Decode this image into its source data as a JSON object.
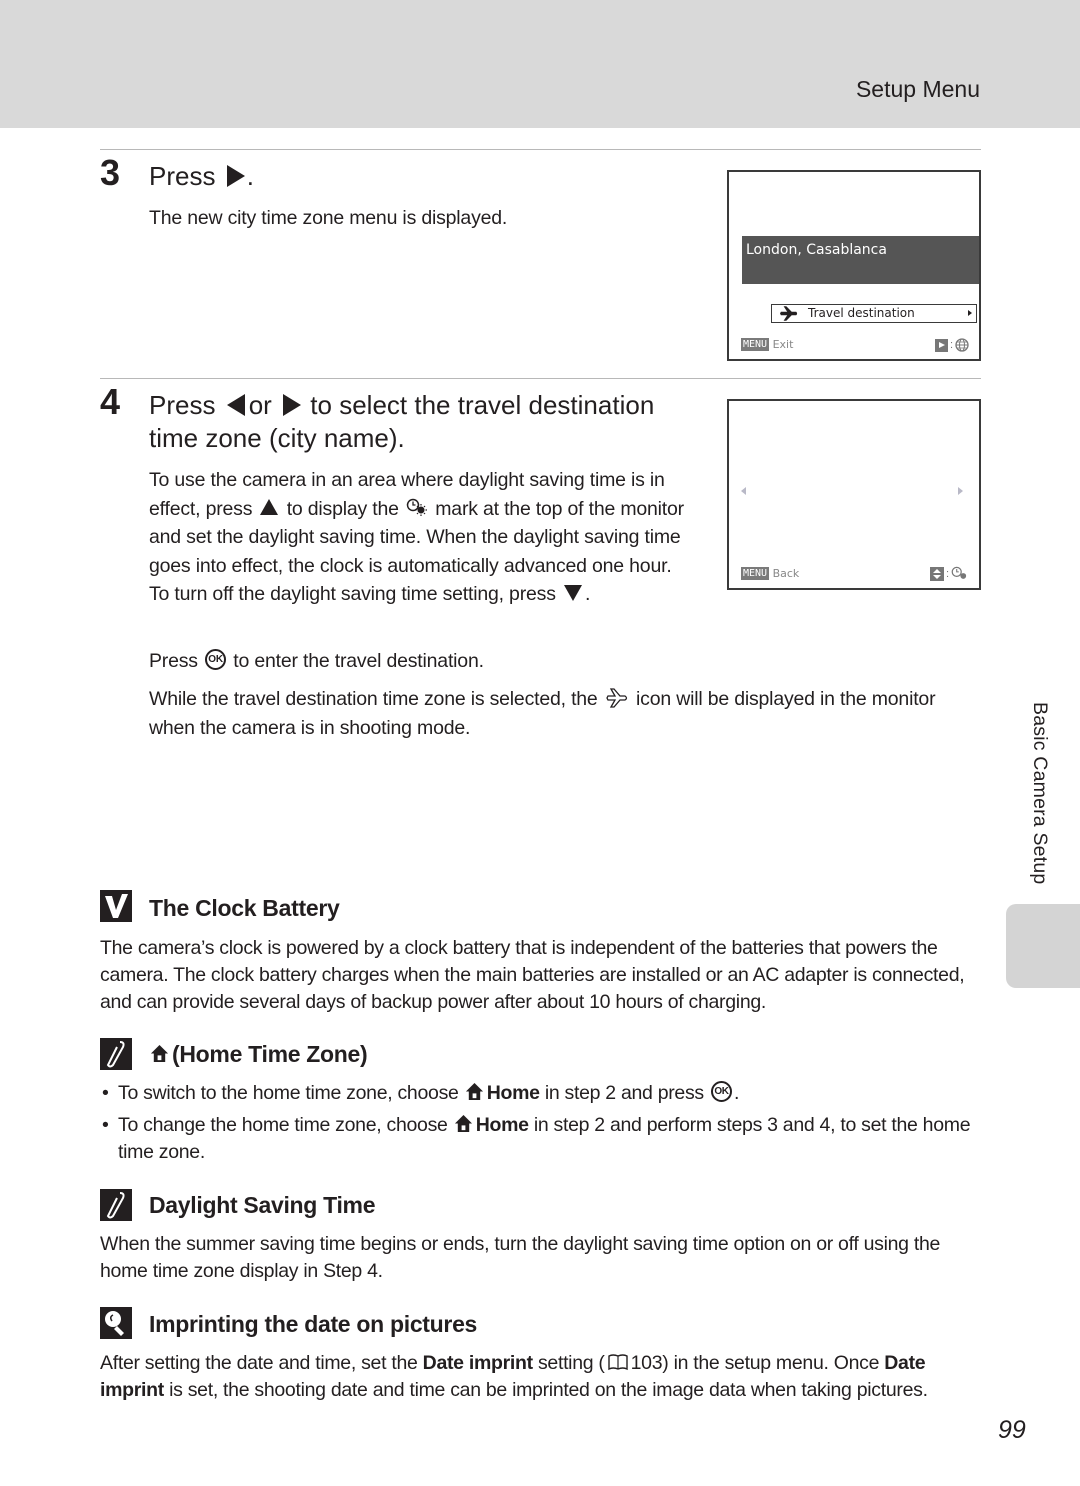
{
  "header": {
    "section_title": "Setup Menu"
  },
  "steps": [
    {
      "number": "3",
      "heading_prefix": "Press",
      "heading_suffix": ".",
      "heading_key_icon": "right-arrow-icon",
      "body": "The new city time zone menu is displayed."
    },
    {
      "number": "4",
      "heading_part1": "Press",
      "heading_part2": "or",
      "heading_part3": "to select the travel destination",
      "heading_line2": "time zone (city name).",
      "body_segments": {
        "s1": "To use the camera in an area where daylight saving time is in effect, press",
        "s2": "to display the",
        "s3": "mark at the top of the monitor and set the daylight saving time. When the daylight saving time goes into effect, the clock is automatically advanced one hour. To turn off the daylight saving time setting, press",
        "s4": "."
      },
      "ok_line": {
        "before": "Press",
        "ok_label": "OK",
        "after": "to enter the travel destination."
      },
      "travel_note": {
        "before": "While the travel destination time zone is selected, the",
        "after": "icon will be displayed in the monitor when the camera is in shooting mode."
      }
    }
  ],
  "camera_screens": [
    {
      "city": "London, Casablanca",
      "option_label": "Travel destination",
      "footer_menu": "MENU",
      "footer_action": "Exit"
    },
    {
      "footer_menu": "MENU",
      "footer_action": "Back"
    }
  ],
  "notes": {
    "clock_battery": {
      "title": "The Clock Battery",
      "body": "The camera’s clock is powered by a clock battery that is independent of the batteries that powers the camera. The clock battery charges when the main batteries are installed or an AC adapter is connected, and can provide several days of backup power after about 10 hours of charging."
    },
    "home_time_zone": {
      "title": "(Home Time Zone)",
      "bullets": [
        {
          "before": "To switch to the home time zone, choose",
          "bold": "Home",
          "after": "in step 2 and press",
          "end": "."
        },
        {
          "before": "To change the home time zone, choose",
          "bold": "Home",
          "after": "in step 2 and perform steps 3 and 4, to set the home time zone."
        }
      ]
    },
    "daylight_saving": {
      "title": "Daylight Saving Time",
      "body": "When the summer saving time begins or ends, turn the daylight saving time option on or off using the home time zone display in Step 4."
    },
    "imprinting": {
      "title": "Imprinting the date on pictures",
      "seg1": "After setting the date and time, set the",
      "bold1": "Date imprint",
      "seg2": "setting (",
      "page_ref": "103",
      "seg3": ") in the setup menu. Once",
      "bold2": "Date imprint",
      "seg4": "is set, the shooting date and time can be imprinted on the image data when taking pictures."
    }
  },
  "sidebar": {
    "chapter_label": "Basic Camera Setup"
  },
  "footer": {
    "page_number": "99"
  },
  "colors": {
    "header_band": "#d9d9d9",
    "city_band": "#555555",
    "side_tab": "#d4d4d4",
    "text": "#231f20"
  }
}
